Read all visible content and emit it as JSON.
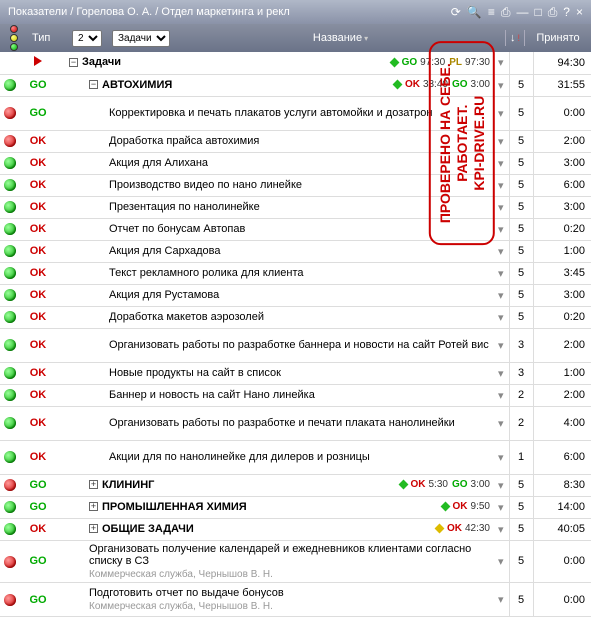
{
  "titlebar": {
    "title": "Показатели / Горелова О. А. / Отдел маркетинга и рекл"
  },
  "header": {
    "type_label": "Тип",
    "num_value": "2",
    "task_value": "Задачи",
    "name_label": "Название",
    "arrow_label": "↓",
    "prinyato_label": "Принято"
  },
  "watermark": {
    "line1": "ПРОВЕРЕНО НА СЕБЕ.",
    "line2": "РАБОТАЕТ.",
    "line3": "KPI-DRIVE.RU"
  },
  "rows": [
    {
      "light": "",
      "type": "play",
      "indent": 1,
      "tree": "minus",
      "name": "Задачи",
      "bold": true,
      "diamond": "green",
      "statuses": [
        [
          "GO",
          "97:30"
        ],
        [
          "PL",
          "97:30"
        ]
      ],
      "dd": "▾",
      "cnt": "",
      "time": "94:30"
    },
    {
      "light": "green",
      "type": "GO",
      "tcol": "go",
      "indent": 2,
      "tree": "minus",
      "name": "АВТОХИМИЯ",
      "bold": true,
      "diamond": "green",
      "statuses": [
        [
          "OK",
          "33:40"
        ],
        [
          "GO",
          "3:00"
        ]
      ],
      "dd": "▾",
      "cnt": "5",
      "time": "31:55"
    },
    {
      "light": "red",
      "type": "GO",
      "tcol": "go",
      "indent": 3,
      "name": "Корректировка и печать плакатов услуги автомойки и дозатрон",
      "two": true,
      "dd": "▾",
      "cnt": "5",
      "time": "0:00"
    },
    {
      "light": "red",
      "type": "OK",
      "tcol": "ok",
      "indent": 3,
      "name": "Доработка прайса автохимия",
      "dd": "▾",
      "cnt": "5",
      "time": "2:00"
    },
    {
      "light": "green",
      "type": "OK",
      "tcol": "ok",
      "indent": 3,
      "name": "Акция для Алихана",
      "dd": "▾",
      "cnt": "5",
      "time": "3:00"
    },
    {
      "light": "green",
      "type": "OK",
      "tcol": "ok",
      "indent": 3,
      "name": "Производство видео по нано линейке",
      "dd": "▾",
      "cnt": "5",
      "time": "6:00"
    },
    {
      "light": "green",
      "type": "OK",
      "tcol": "ok",
      "indent": 3,
      "name": "Презентация по нанолинейке",
      "dd": "▾",
      "cnt": "5",
      "time": "3:00"
    },
    {
      "light": "green",
      "type": "OK",
      "tcol": "ok",
      "indent": 3,
      "name": "Отчет по бонусам Автопав",
      "dd": "▾",
      "cnt": "5",
      "time": "0:20"
    },
    {
      "light": "green",
      "type": "OK",
      "tcol": "ok",
      "indent": 3,
      "name": "Акция для Сархадова",
      "dd": "▾",
      "cnt": "5",
      "time": "1:00"
    },
    {
      "light": "green",
      "type": "OK",
      "tcol": "ok",
      "indent": 3,
      "name": "Текст рекламного ролика для клиента",
      "dd": "▾",
      "cnt": "5",
      "time": "3:45"
    },
    {
      "light": "green",
      "type": "OK",
      "tcol": "ok",
      "indent": 3,
      "name": "Акция для Рустамова",
      "dd": "▾",
      "cnt": "5",
      "time": "3:00"
    },
    {
      "light": "green",
      "type": "OK",
      "tcol": "ok",
      "indent": 3,
      "name": "Доработка макетов аэрозолей",
      "dd": "▾",
      "cnt": "5",
      "time": "0:20"
    },
    {
      "light": "green",
      "type": "OK",
      "tcol": "ok",
      "indent": 3,
      "name": "Организовать работы по разработке баннера и новости на сайт Ротей вис",
      "two": true,
      "dd": "▾",
      "cnt": "3",
      "time": "2:00"
    },
    {
      "light": "green",
      "type": "OK",
      "tcol": "ok",
      "indent": 3,
      "name": "Новые продукты на сайт в список",
      "dd": "▾",
      "cnt": "3",
      "time": "1:00"
    },
    {
      "light": "green",
      "type": "OK",
      "tcol": "ok",
      "indent": 3,
      "name": "Баннер и новость на сайт Нано линейка",
      "dd": "▾",
      "cnt": "2",
      "time": "2:00"
    },
    {
      "light": "green",
      "type": "OK",
      "tcol": "ok",
      "indent": 3,
      "name": "Организовать работы по разработке и печати плаката нанолинейки",
      "two": true,
      "dd": "▾",
      "cnt": "2",
      "time": "4:00"
    },
    {
      "light": "green",
      "type": "OK",
      "tcol": "ok",
      "indent": 3,
      "name": "Акции для по нанолинейке для дилеров и розницы",
      "two": true,
      "dd": "▾",
      "cnt": "1",
      "time": "6:00"
    },
    {
      "light": "red",
      "type": "GO",
      "tcol": "go",
      "indent": 2,
      "tree": "plus",
      "name": "КЛИНИНГ",
      "bold": true,
      "diamond": "green",
      "statuses": [
        [
          "OK",
          "5:30"
        ],
        [
          "GO",
          "3:00"
        ]
      ],
      "dd": "▾",
      "cnt": "5",
      "time": "8:30"
    },
    {
      "light": "green",
      "type": "GO",
      "tcol": "go",
      "indent": 2,
      "tree": "plus",
      "name": "ПРОМЫШЛЕННАЯ ХИМИЯ",
      "bold": true,
      "diamond": "green",
      "statuses": [
        [
          "OK",
          "9:50"
        ]
      ],
      "dd": "▾",
      "cnt": "5",
      "time": "14:00"
    },
    {
      "light": "green",
      "type": "OK",
      "tcol": "ok",
      "indent": 2,
      "tree": "plus",
      "name": "ОБЩИЕ ЗАДАЧИ",
      "bold": true,
      "diamond": "yellow",
      "statuses": [
        [
          "OK",
          "42:30"
        ]
      ],
      "dd": "▾",
      "cnt": "5",
      "time": "40:05"
    },
    {
      "light": "red",
      "type": "GO",
      "tcol": "go",
      "indent": 2,
      "name": "Организовать получение календарей и ежедневников клиентами согласно списку в СЗ",
      "sub": "Коммерческая служба, Чернышов В. Н.",
      "two": true,
      "dd": "▾",
      "cnt": "5",
      "time": "0:00"
    },
    {
      "light": "red",
      "type": "GO",
      "tcol": "go",
      "indent": 2,
      "name": "Подготовить отчет по выдаче бонусов",
      "sub": "Коммерческая служба, Чернышов В. Н.",
      "two": true,
      "dd": "▾",
      "cnt": "5",
      "time": "0:00"
    }
  ]
}
